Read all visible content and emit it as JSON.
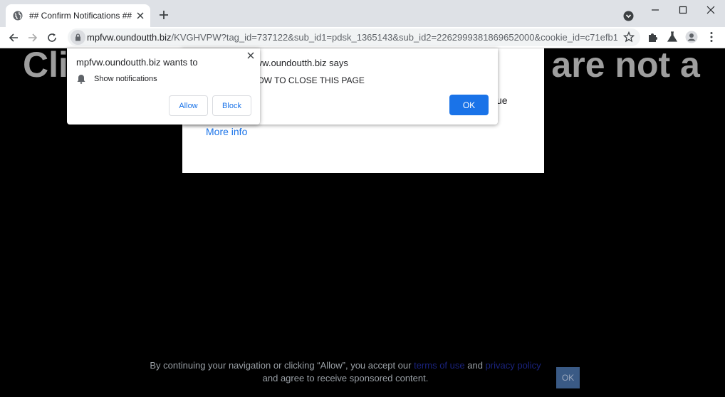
{
  "tab": {
    "title": "## Confirm Notifications ##"
  },
  "omnibox": {
    "host": "mpfvw.oundoutth.biz",
    "path": "/KVGHVPW?tag_id=737122&sub_id1=pdsk_1365143&sub_id2=2262999381869652000&cookie_id=c71efb18-ed4c-4e..."
  },
  "icons": {
    "favicon": "globe-icon",
    "close": "close-icon",
    "new_tab": "plus-icon",
    "tab_search": "tab-search-icon",
    "minimize": "minimize-icon",
    "maximize": "maximize-icon",
    "window_close": "close-icon",
    "back": "back-arrow-icon",
    "forward": "forward-arrow-icon",
    "reload": "reload-icon",
    "lock": "lock-icon",
    "bookmark": "star-icon",
    "extensions": "puzzle-icon",
    "labs": "flask-icon",
    "profile": "avatar-icon",
    "menu": "kebab-menu-icon",
    "bell": "bell-icon"
  },
  "page": {
    "headline_left": "Cli",
    "headline_right": "u are not a",
    "card_partial": "ue",
    "more_info": "More info"
  },
  "alert": {
    "title": "mpfvw.oundoutth.biz says",
    "message": "ALLOW TO CLOSE THIS PAGE",
    "ok_label": "OK"
  },
  "permission": {
    "title": "mpfvw.oundoutth.biz wants to",
    "item": "Show notifications",
    "allow_label": "Allow",
    "block_label": "Block"
  },
  "consent": {
    "text1": "By continuing your navigation or clicking “Allow”, you accept our",
    "link1": "terms of use",
    "and": "and",
    "link2": "privacy policy",
    "text2": "and agree to receive sponsored content.",
    "ok_label": "OK"
  },
  "colors": {
    "accent": "#1a73e8",
    "page_bg": "#000000",
    "headline": "#9e9e9e"
  }
}
